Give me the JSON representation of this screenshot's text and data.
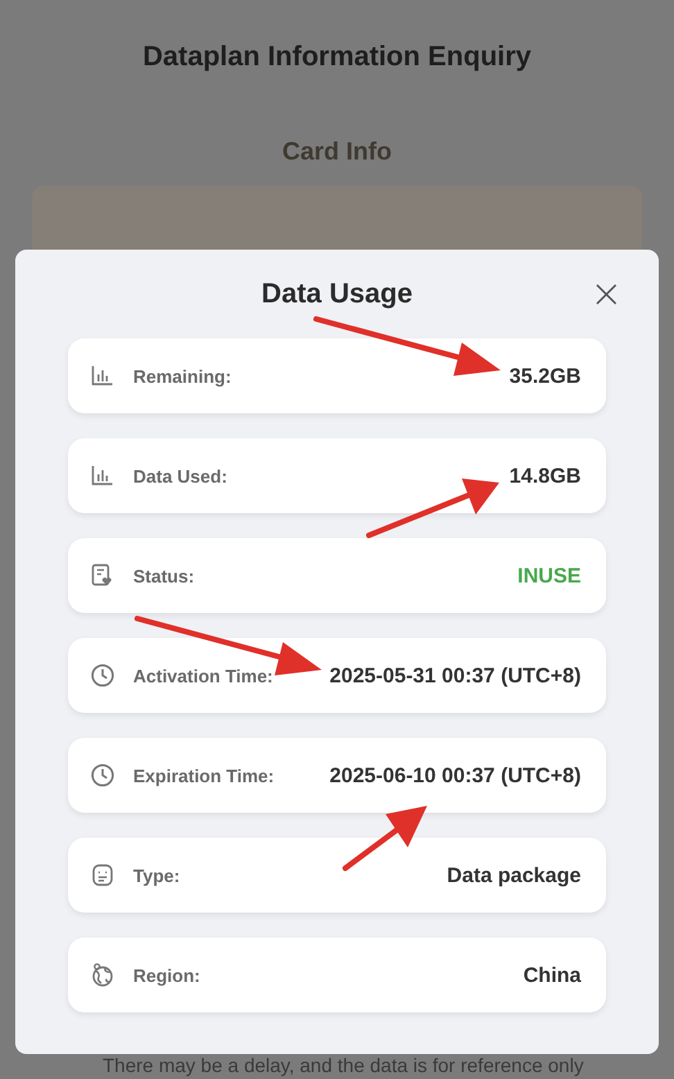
{
  "page": {
    "title": "Dataplan Information Enquiry",
    "section_title": "Card Info",
    "footer_note": "There may be a delay, and the data is for reference only"
  },
  "dialog": {
    "title": "Data Usage",
    "close": "×",
    "rows": [
      {
        "kind": "chart",
        "label": "Remaining:",
        "value": "35.2GB",
        "annotated": true
      },
      {
        "kind": "chart",
        "label": "Data Used:",
        "value": "14.8GB",
        "annotated": true
      },
      {
        "kind": "status",
        "label": "Status:",
        "value": "INUSE",
        "color": "#49a84d",
        "annotated": false
      },
      {
        "kind": "clock",
        "label": "Activation Time:",
        "value": "2025-05-31 00:37 (UTC+8)",
        "annotated": true
      },
      {
        "kind": "clock",
        "label": "Expiration Time:",
        "value": "2025-06-10 00:37 (UTC+8)",
        "annotated": true
      },
      {
        "kind": "type",
        "label": "Type:",
        "value": "Data package",
        "annotated": false
      },
      {
        "kind": "globe",
        "label": "Region:",
        "value": "China",
        "annotated": false
      }
    ]
  }
}
